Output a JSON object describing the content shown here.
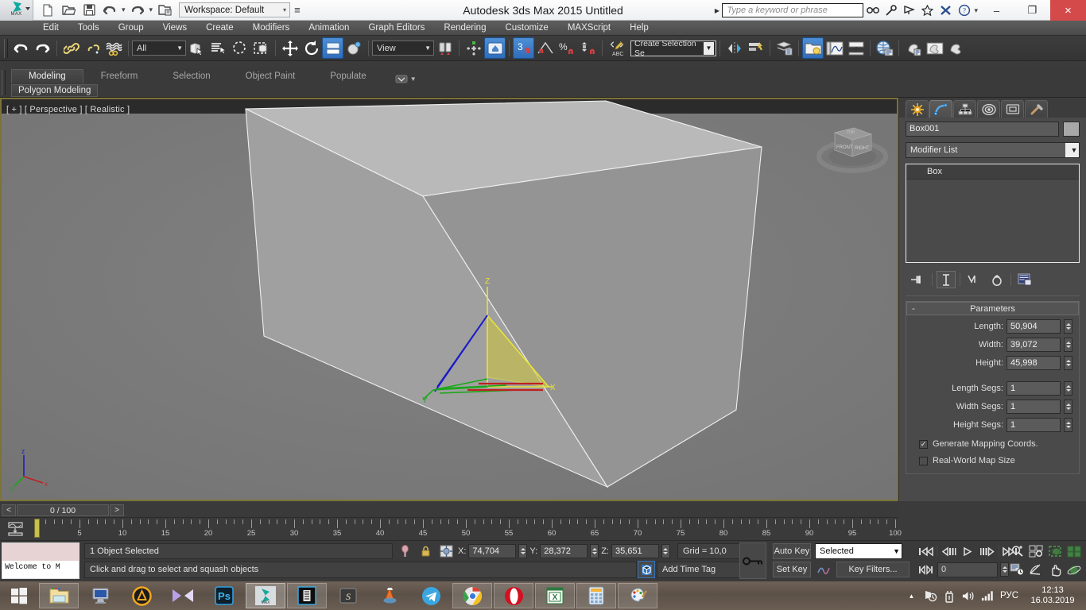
{
  "titlebar": {
    "app_title": "Autodesk 3ds Max  2015     Untitled",
    "logo_label": "MAX",
    "workspace_label": "Workspace: Default",
    "quick_access": [
      {
        "name": "new-file-icon",
        "label": "New"
      },
      {
        "name": "open-file-icon",
        "label": "Open"
      },
      {
        "name": "save-file-icon",
        "label": "Save"
      },
      {
        "name": "undo-icon",
        "label": "Undo"
      },
      {
        "name": "redo-icon",
        "label": "Redo"
      },
      {
        "name": "project-folder-icon",
        "label": "Set Project Folder"
      }
    ],
    "infocenter": {
      "placeholder": "Type a keyword or phrase",
      "icons": [
        "search-icon",
        "subscription-key-icon",
        "communication-center-icon",
        "favorites-star-icon",
        "exchange-app-icon",
        "help-icon"
      ]
    },
    "window_controls": {
      "minimize": "–",
      "maximize": "❐",
      "close": "×"
    }
  },
  "menubar": {
    "items": [
      "Edit",
      "Tools",
      "Group",
      "Views",
      "Create",
      "Modifiers",
      "Animation",
      "Graph Editors",
      "Rendering",
      "Customize",
      "MAXScript",
      "Help"
    ]
  },
  "main_toolbar": {
    "selection_filter": "All",
    "reference_coordinate_system": "View",
    "named_selection_set": "Create Selection Se",
    "buttons": [
      {
        "name": "undo-scene-operation-button",
        "label": "Undo"
      },
      {
        "name": "redo-scene-operation-button",
        "label": "Redo"
      },
      {
        "name": "select-and-link-button",
        "label": "Select and Link"
      },
      {
        "name": "unlink-selection-button",
        "label": "Unlink Selection"
      },
      {
        "name": "bind-to-space-warp-button",
        "label": "Bind to Space Warp"
      },
      {
        "name": "select-object-button",
        "label": "Select Object"
      },
      {
        "name": "select-by-name-button",
        "label": "Select by Name"
      },
      {
        "name": "select-region-circle-button",
        "label": "Circular Selection Region"
      },
      {
        "name": "window-crossing-button",
        "label": "Window/Crossing"
      },
      {
        "name": "select-and-move-button",
        "label": "Select and Move"
      },
      {
        "name": "select-and-rotate-button",
        "label": "Select and Rotate"
      },
      {
        "name": "select-and-squash-button",
        "label": "Select and Squash"
      },
      {
        "name": "select-and-manipulate-button",
        "label": "Select and Manipulate"
      },
      {
        "name": "keyboard-shortcut-override-button",
        "label": "Keyboard Shortcut Override Toggle"
      },
      {
        "name": "snaps-toggle-button",
        "label": "3 Snaps Toggle"
      },
      {
        "name": "angle-snap-toggle-button",
        "label": "Angle Snap Toggle"
      },
      {
        "name": "percent-snap-toggle-button",
        "label": "Percent Snap Toggle"
      },
      {
        "name": "spinner-snap-toggle-button",
        "label": "Spinner Snap Toggle"
      },
      {
        "name": "edit-named-selection-sets-button",
        "label": "Edit Named Selection Sets"
      },
      {
        "name": "mirror-button",
        "label": "Mirror"
      },
      {
        "name": "align-button",
        "label": "Align"
      },
      {
        "name": "layer-explorer-button",
        "label": "Layer Explorer"
      },
      {
        "name": "toggle-scene-explorer-button",
        "label": "Toggle Scene Explorer"
      },
      {
        "name": "curve-editor-button",
        "label": "Curve Editor"
      },
      {
        "name": "schematic-view-button",
        "label": "Schematic View"
      },
      {
        "name": "material-editor-button",
        "label": "Material Editor"
      },
      {
        "name": "render-setup-button",
        "label": "Render Setup"
      },
      {
        "name": "rendered-frame-window-button",
        "label": "Rendered Frame Window"
      },
      {
        "name": "render-production-button",
        "label": "Render Production"
      }
    ]
  },
  "ribbon": {
    "tabs": [
      {
        "label": "Modeling",
        "selected": true
      },
      {
        "label": "Freeform",
        "selected": false
      },
      {
        "label": "Selection",
        "selected": false
      },
      {
        "label": "Object Paint",
        "selected": false
      },
      {
        "label": "Populate",
        "selected": false
      }
    ],
    "subtab": "Polygon Modeling",
    "dropdown_icon": "ribbon-minimize-icon"
  },
  "viewport": {
    "label": "[ + ] [ Perspective ] [ Realistic ]",
    "viewcube": {
      "front": "FRONT",
      "right": "RIGHT",
      "top": "TOP"
    },
    "gizmo_axes": [
      "Z",
      "X",
      "Y"
    ],
    "world_axis": [
      "z",
      "x",
      "y"
    ],
    "colors": {
      "background": "#7a7a7a",
      "active_border": "#7c7339",
      "box_top": "#b4b4b4",
      "box_front": "#9b9b9b",
      "box_side": "#8d8d8d",
      "axis_x": "#cc2222",
      "axis_y": "#22aa22",
      "axis_z": "#2222cc",
      "gizmo_highlight": "#e8e23a"
    }
  },
  "command_panel": {
    "tabs": [
      {
        "name": "create-tab",
        "label": "Create",
        "selected": false
      },
      {
        "name": "modify-tab",
        "label": "Modify",
        "selected": true
      },
      {
        "name": "hierarchy-tab",
        "label": "Hierarchy",
        "selected": false
      },
      {
        "name": "motion-tab",
        "label": "Motion",
        "selected": false
      },
      {
        "name": "display-tab",
        "label": "Display",
        "selected": false
      },
      {
        "name": "utilities-tab",
        "label": "Utilities",
        "selected": false
      }
    ],
    "object_name": "Box001",
    "modifier_list_label": "Modifier List",
    "stack_items": [
      "Box"
    ],
    "stack_buttons": [
      {
        "name": "pin-stack-icon",
        "label": "Pin Stack"
      },
      {
        "name": "show-end-result-icon",
        "label": "Show end result on/off toggle"
      },
      {
        "name": "make-unique-icon",
        "label": "Make unique"
      },
      {
        "name": "remove-modifier-icon",
        "label": "Remove modifier from the stack"
      },
      {
        "name": "configure-modifier-sets-icon",
        "label": "Configure Modifier Sets"
      }
    ],
    "rollout": {
      "title": "Parameters",
      "toggle": "-",
      "fields": [
        {
          "label": "Length:",
          "value": "50,904"
        },
        {
          "label": "Width:",
          "value": "39,072"
        },
        {
          "label": "Height:",
          "value": "45,998"
        }
      ],
      "segs": [
        {
          "label": "Length Segs:",
          "value": "1"
        },
        {
          "label": "Width Segs:",
          "value": "1"
        },
        {
          "label": "Height Segs:",
          "value": "1"
        }
      ],
      "checkboxes": [
        {
          "label": "Generate Mapping Coords.",
          "checked": true
        },
        {
          "label": "Real-World Map Size",
          "checked": false
        }
      ]
    }
  },
  "timebar": {
    "prev_arrow": "<",
    "next_arrow": ">",
    "current_frame": "0 / 100",
    "ruler_min": 0,
    "ruler_max": 100,
    "ruler_step": 5,
    "ruler_labels": [
      "5",
      "10",
      "15",
      "20",
      "25",
      "30",
      "35",
      "40",
      "45",
      "50",
      "55",
      "60",
      "65",
      "70",
      "75",
      "80",
      "85",
      "90",
      "95",
      "100"
    ],
    "slider_position": 0,
    "open_mini_curve_editor": "open-mini-curve-editor-icon"
  },
  "status": {
    "maxscript_prompt": "Welcome to M",
    "selection_info": "1 Object Selected",
    "prompt_line": "Click and drag to select and squash objects",
    "coords": [
      {
        "label": "X:",
        "value": "74,704"
      },
      {
        "label": "Y:",
        "value": "28,372"
      },
      {
        "label": "Z:",
        "value": "35,651"
      }
    ],
    "grid_text": "Grid = 10,0",
    "add_time_tag": "Add Time Tag",
    "icons": [
      {
        "name": "isolate-selection-icon",
        "label": "Isolate Selection Toggle"
      },
      {
        "name": "selection-lock-icon",
        "label": "Selection Lock Toggle"
      },
      {
        "name": "absolute-relative-mode-icon",
        "label": "Absolute/Relative Transform Type-In"
      },
      {
        "name": "adaptive-degradation-icon",
        "label": "Adaptive Degradation Toggle"
      },
      {
        "name": "key-mode-icon",
        "label": "Key Mode Toggle"
      }
    ]
  },
  "animation": {
    "auto_key": "Auto Key",
    "set_key": "Set Key",
    "key_filters": "Key Filters...",
    "selection_level": "Selected",
    "current_frame_field": "0",
    "playback_buttons": [
      {
        "name": "go-to-start-button",
        "label": "Go to Start"
      },
      {
        "name": "previous-frame-button",
        "label": "Previous Frame"
      },
      {
        "name": "play-animation-button",
        "label": "Play Animation"
      },
      {
        "name": "next-frame-button",
        "label": "Next Frame"
      },
      {
        "name": "go-to-end-button",
        "label": "Go to End"
      },
      {
        "name": "key-mode-toggle-button",
        "label": "Key Mode Toggle"
      }
    ],
    "nav_buttons": [
      {
        "name": "zoom-button",
        "label": "Zoom"
      },
      {
        "name": "zoom-all-button",
        "label": "Zoom All"
      },
      {
        "name": "zoom-extents-button",
        "label": "Zoom Extents"
      },
      {
        "name": "zoom-region-button",
        "label": "Zoom Region"
      },
      {
        "name": "time-configuration-button",
        "label": "Time Configuration"
      },
      {
        "name": "field-of-view-button",
        "label": "Field-of-View"
      },
      {
        "name": "pan-view-button",
        "label": "Pan View"
      },
      {
        "name": "orbit-button",
        "label": "Orbit"
      },
      {
        "name": "maximize-viewport-button",
        "label": "Maximize Viewport Toggle"
      }
    ]
  },
  "taskbar": {
    "start_label": "Start",
    "items": [
      {
        "name": "taskbar-file-explorer",
        "label": "File Explorer",
        "state": "run"
      },
      {
        "name": "taskbar-my-computer",
        "label": "Computer",
        "state": "none"
      },
      {
        "name": "taskbar-aimp",
        "label": "AIMP",
        "state": "none"
      },
      {
        "name": "taskbar-media-player",
        "label": "Media Player Classic",
        "state": "none"
      },
      {
        "name": "taskbar-photoshop",
        "label": "Adobe Photoshop",
        "state": "none"
      },
      {
        "name": "taskbar-3dsmax",
        "label": "Autodesk 3ds Max",
        "state": "act"
      },
      {
        "name": "taskbar-video-editor",
        "label": "Video Editor",
        "state": "run"
      },
      {
        "name": "taskbar-sublime",
        "label": "Sublime Text",
        "state": "none"
      },
      {
        "name": "taskbar-vlc",
        "label": "VLC",
        "state": "none"
      },
      {
        "name": "taskbar-telegram",
        "label": "Telegram",
        "state": "none"
      },
      {
        "name": "taskbar-chrome",
        "label": "Google Chrome",
        "state": "run"
      },
      {
        "name": "taskbar-opera",
        "label": "Opera",
        "state": "run"
      },
      {
        "name": "taskbar-excel",
        "label": "Microsoft Excel",
        "state": "run"
      },
      {
        "name": "taskbar-calculator",
        "label": "Calculator",
        "state": "run"
      },
      {
        "name": "taskbar-paint",
        "label": "Paint",
        "state": "run"
      }
    ],
    "tray": {
      "overflow": "▲",
      "language": "РУС",
      "time": "12:13",
      "date": "16.03.2019",
      "icons": [
        "network-icon",
        "usb-icon",
        "volume-icon",
        "signal-icon"
      ]
    }
  }
}
